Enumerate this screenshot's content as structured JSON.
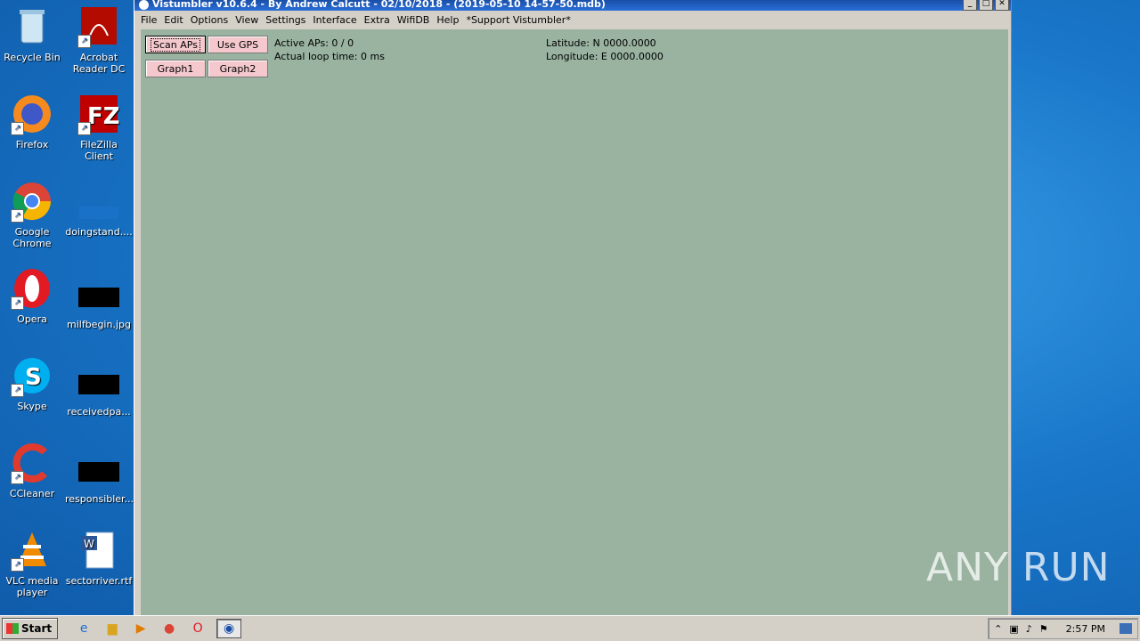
{
  "desktop": {
    "icons": [
      {
        "label": "Recycle Bin"
      },
      {
        "label": "Acrobat Reader DC"
      },
      {
        "label": "Firefox"
      },
      {
        "label": "FileZilla Client"
      },
      {
        "label": "Google Chrome"
      },
      {
        "label": "doingstand...."
      },
      {
        "label": "Opera"
      },
      {
        "label": "milfbegin.jpg"
      },
      {
        "label": "Skype"
      },
      {
        "label": "receivedpa..."
      },
      {
        "label": "CCleaner"
      },
      {
        "label": "responsibler..."
      },
      {
        "label": "VLC media player"
      },
      {
        "label": "sectorriver.rtf"
      }
    ],
    "watermark": "ANY RUN"
  },
  "window": {
    "title": "Vistumbler v10.6.4 - By Andrew Calcutt - 02/10/2018 - (2019-05-10 14-57-50.mdb)",
    "menu": [
      "File",
      "Edit",
      "Options",
      "View",
      "Settings",
      "Interface",
      "Extra",
      "WifiDB",
      "Help",
      "*Support Vistumbler*"
    ],
    "buttons": {
      "scan_aps": "Scan APs",
      "use_gps": "Use GPS",
      "graph1": "Graph1",
      "graph2": "Graph2"
    },
    "status": {
      "active_aps": "Active APs: 0 / 0",
      "loop_time": "Actual loop time: 0 ms",
      "latitude": "Latitude: N 0000.0000",
      "longitude": "Longitude: E 0000.0000"
    },
    "colors": {
      "client_bg": "#99b3a0",
      "button_bg": "#f4c8cc"
    }
  },
  "taskbar": {
    "start_label": "Start",
    "clock": "2:57 PM"
  }
}
